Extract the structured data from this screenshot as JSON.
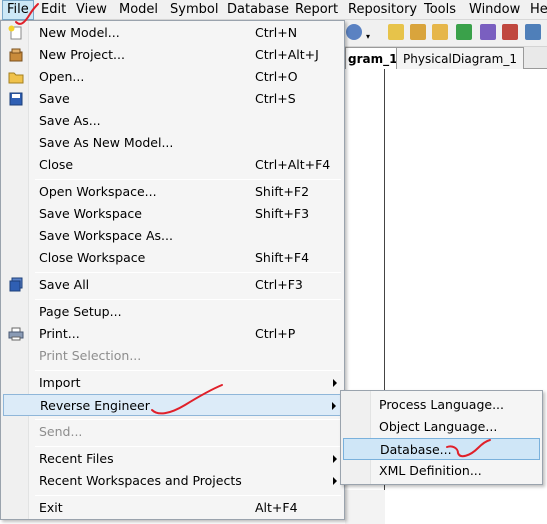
{
  "menubar": {
    "items": [
      "File",
      "Edit",
      "View",
      "Model",
      "Symbol",
      "Database",
      "Report",
      "Repository",
      "Tools",
      "Window",
      "He"
    ]
  },
  "tabs": [
    "gram_1",
    "PhysicalDiagram_1"
  ],
  "file_menu": {
    "items": [
      {
        "label": "New Model...",
        "shortcut": "Ctrl+N"
      },
      {
        "label": "New Project...",
        "shortcut": "Ctrl+Alt+J"
      },
      {
        "label": "Open...",
        "shortcut": "Ctrl+O"
      },
      {
        "label": "Save",
        "shortcut": "Ctrl+S"
      },
      {
        "label": "Save As...",
        "shortcut": ""
      },
      {
        "label": "Save As New Model...",
        "shortcut": ""
      },
      {
        "label": "Close",
        "shortcut": "Ctrl+Alt+F4"
      },
      {
        "label": "Open Workspace...",
        "shortcut": "Shift+F2"
      },
      {
        "label": "Save Workspace",
        "shortcut": "Shift+F3"
      },
      {
        "label": "Save Workspace As...",
        "shortcut": ""
      },
      {
        "label": "Close Workspace",
        "shortcut": "Shift+F4"
      },
      {
        "label": "Save All",
        "shortcut": "Ctrl+F3"
      },
      {
        "label": "Page Setup...",
        "shortcut": ""
      },
      {
        "label": "Print...",
        "shortcut": "Ctrl+P"
      },
      {
        "label": "Print Selection...",
        "shortcut": ""
      },
      {
        "label": "Import",
        "shortcut": ""
      },
      {
        "label": "Reverse Engineer",
        "shortcut": ""
      },
      {
        "label": "Send...",
        "shortcut": ""
      },
      {
        "label": "Recent Files",
        "shortcut": ""
      },
      {
        "label": "Recent Workspaces and Projects",
        "shortcut": ""
      },
      {
        "label": "Exit",
        "shortcut": "Alt+F4"
      }
    ]
  },
  "reverse_engineer_submenu": {
    "items": [
      "Process Language...",
      "Object Language...",
      "Database...",
      "XML Definition..."
    ]
  },
  "colors": {
    "highlight": "#cfe6f7",
    "annotation": "#e0202a",
    "disabled_text": "#8d8d8d"
  }
}
